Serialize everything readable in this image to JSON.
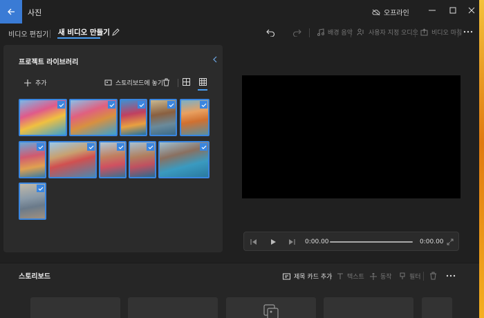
{
  "app": {
    "title": "사진",
    "offline_label": "오프라인"
  },
  "toolbar": {
    "video_editor": "비디오 편집기",
    "new_video": "새 비디오 만들기",
    "background_music": "배경 음악",
    "custom_audio": "사용자 지정 오디오",
    "finish_video": "비디오 마침"
  },
  "library": {
    "title": "프로젝트 라이브러리",
    "add_label": "추가",
    "place_in_storyboard": "스토리보드에 놓기"
  },
  "player": {
    "current_time": "0:00.00",
    "end_time": "0:00.00",
    "progress": 0
  },
  "storyboard": {
    "title": "스토리보드",
    "add_title_card": "제목 카드 추가",
    "text": "텍스트",
    "motion": "동작",
    "filter": "필터"
  },
  "icons": [
    "back-arrow-icon",
    "cloud-off-icon",
    "minimize-icon",
    "maximize-icon",
    "close-icon",
    "pen-icon",
    "undo-icon",
    "redo-icon",
    "music-icon",
    "custom-audio-icon",
    "export-icon",
    "more-icon",
    "chevron-left-icon",
    "plus-icon",
    "storyboard-icon",
    "trash-icon",
    "grid-large-icon",
    "grid-small-icon",
    "checkmark-icon",
    "prev-frame-icon",
    "play-icon",
    "next-frame-icon",
    "fullscreen-icon",
    "title-card-icon",
    "text-icon",
    "motion-icon",
    "filter-icon",
    "placeholder-images-icon"
  ],
  "colors": {
    "accent": "#3a86e0",
    "background": "#202020",
    "panel": "#2b2b2b",
    "preview": "#000000"
  }
}
